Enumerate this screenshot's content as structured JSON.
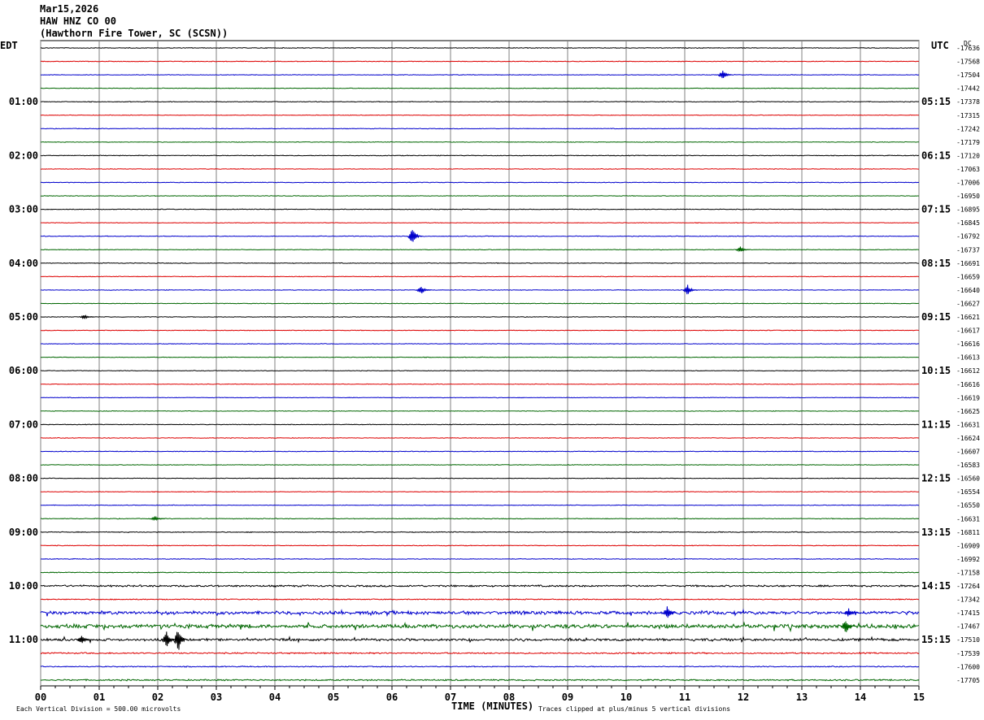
{
  "header": {
    "date": "Mar15,2026",
    "channel": "HAW HNZ CO 00",
    "station": "(Hawthorn Fire Tower, SC (SCSN))"
  },
  "colors": {
    "black": "#000000",
    "red": "#dd0000",
    "blue": "#0000cc",
    "green": "#006600",
    "grid": "#808080"
  },
  "chart_data": {
    "type": "line",
    "left_axis_label": "EDT",
    "right_axis_label": "UTC",
    "dc_label": "DC",
    "xlabel": "TIME (MINUTES)",
    "xlim": [
      0,
      15
    ],
    "x_ticks": [
      "00",
      "01",
      "02",
      "03",
      "04",
      "05",
      "06",
      "07",
      "08",
      "09",
      "10",
      "11",
      "12",
      "13",
      "14",
      "15"
    ],
    "edt_hours": [
      "01:00",
      "02:00",
      "03:00",
      "04:00",
      "05:00",
      "06:00",
      "07:00",
      "08:00",
      "09:00",
      "10:00",
      "11:00"
    ],
    "utc_hours": [
      "05:15",
      "06:15",
      "07:15",
      "08:15",
      "09:15",
      "10:15",
      "11:15",
      "12:15",
      "13:15",
      "14:15",
      "15:15"
    ],
    "dc_offsets": [
      "-17636",
      "-17568",
      "-17504",
      "-17442",
      "-17378",
      "-17315",
      "-17242",
      "-17179",
      "-17120",
      "-17063",
      "-17006",
      "-16950",
      "-16895",
      "-16845",
      "-16792",
      "-16737",
      "-16691",
      "-16659",
      "-16640",
      "-16627",
      "-16621",
      "-16617",
      "-16616",
      "-16613",
      "-16612",
      "-16616",
      "-16619",
      "-16625",
      "-16631",
      "-16624",
      "-16607",
      "-16583",
      "-16560",
      "-16554",
      "-16550",
      "-16631",
      "-16811",
      "-16909",
      "-16992",
      "-17158",
      "-17264",
      "-17342",
      "-17415",
      "-17467",
      "-17510",
      "-17539",
      "-17600",
      "-17705"
    ],
    "trace_activity": [
      0.35,
      0.3,
      0.3,
      0.3,
      0.35,
      0.3,
      0.3,
      0.3,
      0.35,
      0.3,
      0.3,
      0.3,
      0.35,
      0.3,
      0.35,
      0.3,
      0.35,
      0.3,
      0.3,
      0.3,
      0.3,
      0.3,
      0.3,
      0.3,
      0.3,
      0.3,
      0.3,
      0.3,
      0.3,
      0.3,
      0.3,
      0.3,
      0.3,
      0.3,
      0.3,
      0.35,
      0.4,
      0.35,
      0.35,
      0.4,
      0.9,
      0.5,
      1.6,
      1.9,
      1.2,
      0.7,
      0.5,
      0.7
    ],
    "events": [
      {
        "row": 2,
        "minute": 11.65,
        "amp": 7
      },
      {
        "row": 14,
        "minute": 6.35,
        "amp": 12
      },
      {
        "row": 15,
        "minute": 11.95,
        "amp": 4
      },
      {
        "row": 18,
        "minute": 6.5,
        "amp": 6
      },
      {
        "row": 18,
        "minute": 11.05,
        "amp": 7
      },
      {
        "row": 20,
        "minute": 0.75,
        "amp": 3
      },
      {
        "row": 35,
        "minute": 1.95,
        "amp": 3
      },
      {
        "row": 42,
        "minute": 10.7,
        "amp": 9
      },
      {
        "row": 42,
        "minute": 13.8,
        "amp": 6
      },
      {
        "row": 43,
        "minute": 13.75,
        "amp": 10
      },
      {
        "row": 44,
        "minute": 2.35,
        "amp": 16
      },
      {
        "row": 44,
        "minute": 2.15,
        "amp": 11
      },
      {
        "row": 44,
        "minute": 0.7,
        "amp": 6
      }
    ],
    "footer_left": "Each Vertical Division =  500.00 microvolts",
    "footer_right": "Traces clipped at plus/minus 5 vertical divisions"
  }
}
